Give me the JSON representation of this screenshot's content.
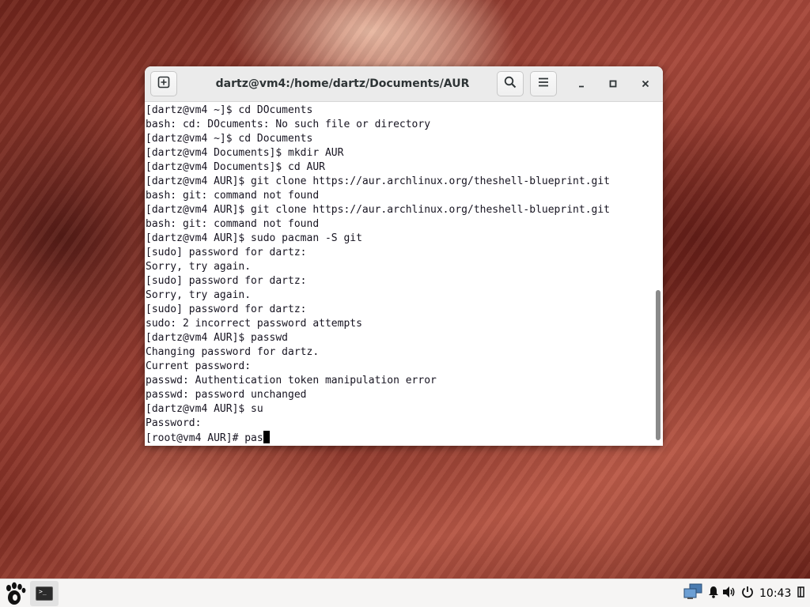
{
  "window": {
    "title": "dartz@vm4:/home/dartz/Documents/AUR"
  },
  "terminal": {
    "lines": [
      "[dartz@vm4 ~]$ cd DOcuments",
      "bash: cd: DOcuments: No such file or directory",
      "[dartz@vm4 ~]$ cd Documents",
      "[dartz@vm4 Documents]$ mkdir AUR",
      "[dartz@vm4 Documents]$ cd AUR",
      "[dartz@vm4 AUR]$ git clone https://aur.archlinux.org/theshell-blueprint.git",
      "bash: git: command not found",
      "[dartz@vm4 AUR]$ git clone https://aur.archlinux.org/theshell-blueprint.git",
      "bash: git: command not found",
      "[dartz@vm4 AUR]$ sudo pacman -S git",
      "[sudo] password for dartz:",
      "Sorry, try again.",
      "[sudo] password for dartz:",
      "Sorry, try again.",
      "[sudo] password for dartz:",
      "sudo: 2 incorrect password attempts",
      "[dartz@vm4 AUR]$ passwd",
      "Changing password for dartz.",
      "Current password:",
      "passwd: Authentication token manipulation error",
      "passwd: password unchanged",
      "[dartz@vm4 AUR]$ su",
      "Password:"
    ],
    "current_line": "[root@vm4 AUR]# pas"
  },
  "icons": {
    "new_tab": "new-tab-icon",
    "search": "search-icon",
    "menu": "hamburger-menu-icon",
    "minimize": "minimize-icon",
    "maximize": "maximize-icon",
    "close": "close-icon",
    "gnome": "gnome-foot-icon",
    "terminal_app": "terminal-icon",
    "network": "network-icon",
    "notifications": "bell-icon",
    "volume": "volume-icon",
    "power": "power-icon",
    "show_desktop": "show-desktop-icon"
  },
  "taskbar": {
    "clock": "10:43"
  }
}
